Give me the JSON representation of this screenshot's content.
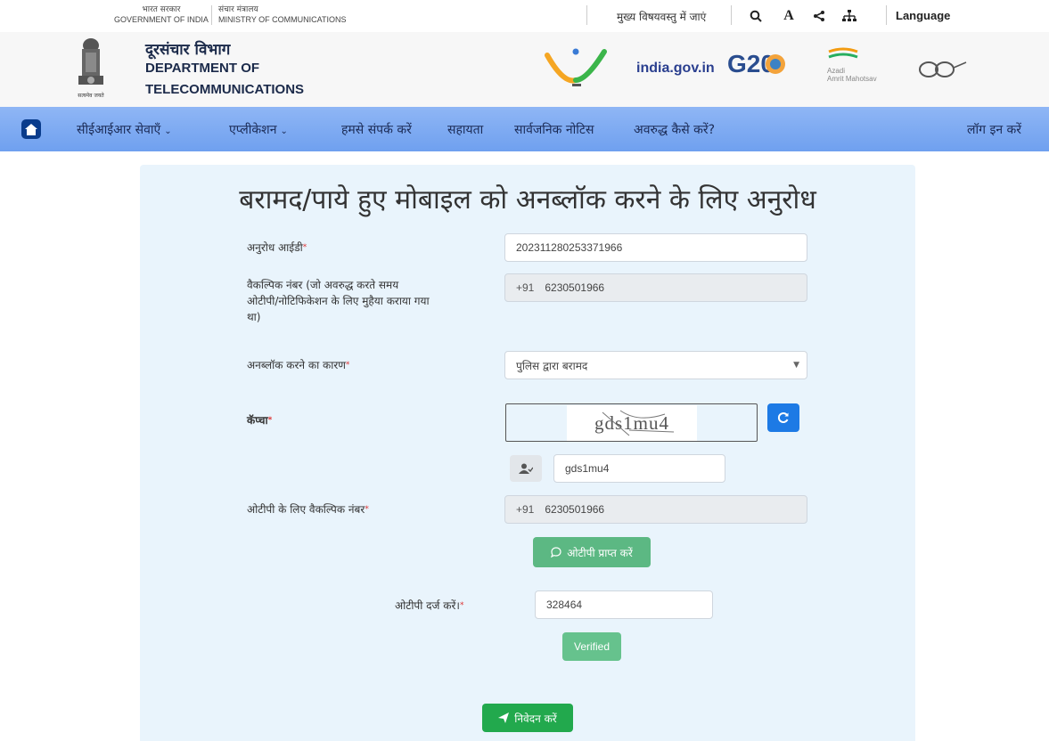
{
  "top_bar": {
    "gov_hi": "भारत सरकार",
    "gov_en": "GOVERNMENT OF INDIA",
    "ministry_hi": "संचार मंत्रालय",
    "ministry_en": "MINISTRY OF COMMUNICATIONS",
    "skip_to_content": "मुख्य विषयवस्तु में जाएं",
    "font_size_label": "A",
    "language_label": "Language"
  },
  "header": {
    "emblem_caption": "सत्यमेव जयते",
    "dept_hi": "दूरसंचार विभाग",
    "dept_en_line1": "DEPARTMENT OF",
    "dept_en_line2": "TELECOMMUNICATIONS",
    "logo_indiagov": "india.gov.in",
    "logo_g20": "G20",
    "logo_azadi_line1": "Azadi",
    "logo_azadi_line2": "Amrit Mahotsav"
  },
  "nav": {
    "items": [
      {
        "label": "सीईआईआर सेवाएँ",
        "dropdown": true
      },
      {
        "label": "एप्लीकेशन",
        "dropdown": true
      },
      {
        "label": "हमसे संपर्क करें",
        "dropdown": false
      },
      {
        "label": "सहायता",
        "dropdown": false
      },
      {
        "label": "सार्वजनिक नोटिस",
        "dropdown": false
      },
      {
        "label": "अवरुद्ध कैसे करें?",
        "dropdown": false
      }
    ],
    "login_label": "लॉग इन करें"
  },
  "form": {
    "title": "बरामद/पाये हुए मोबाइल को अनब्लॉक करने के लिए अनुरोध",
    "request_id_label": "अनुरोध आईडी",
    "request_id_value": "202311280253371966",
    "alt_number_label_line1": "वैकल्पिक नंबर (जो अवरुद्ध करते समय",
    "alt_number_label_line2": "ओटीपी/नोटिफिकेशन के लिए मुहैया कराया गया",
    "alt_number_label_line3": "था)",
    "country_code": "+91",
    "alt_number_value": "6230501966",
    "reason_label": "अनब्लॉक करने का कारण",
    "reason_value": "पुलिस द्वारा बरामद",
    "captcha_label": "कॅप्चा",
    "captcha_image_text": "gds1mu4",
    "captcha_input_value": "gds1mu4",
    "otp_number_label": "ओटीपी के लिए वैकल्पिक नंबर",
    "otp_number_value": "6230501966",
    "get_otp_button": "ओटीपी प्राप्त करें",
    "enter_otp_label": "ओटीपी दर्ज करें।",
    "otp_value": "328464",
    "verified_button": "Verified",
    "submit_button": "निवेदन करें"
  },
  "colors": {
    "nav_bg": "#7aa8f0",
    "card_bg": "#e9f4fc",
    "primary_blue": "#1d7ae5",
    "green_light": "#5cb883",
    "green_submit": "#22a94d",
    "required_red": "#d33333"
  }
}
